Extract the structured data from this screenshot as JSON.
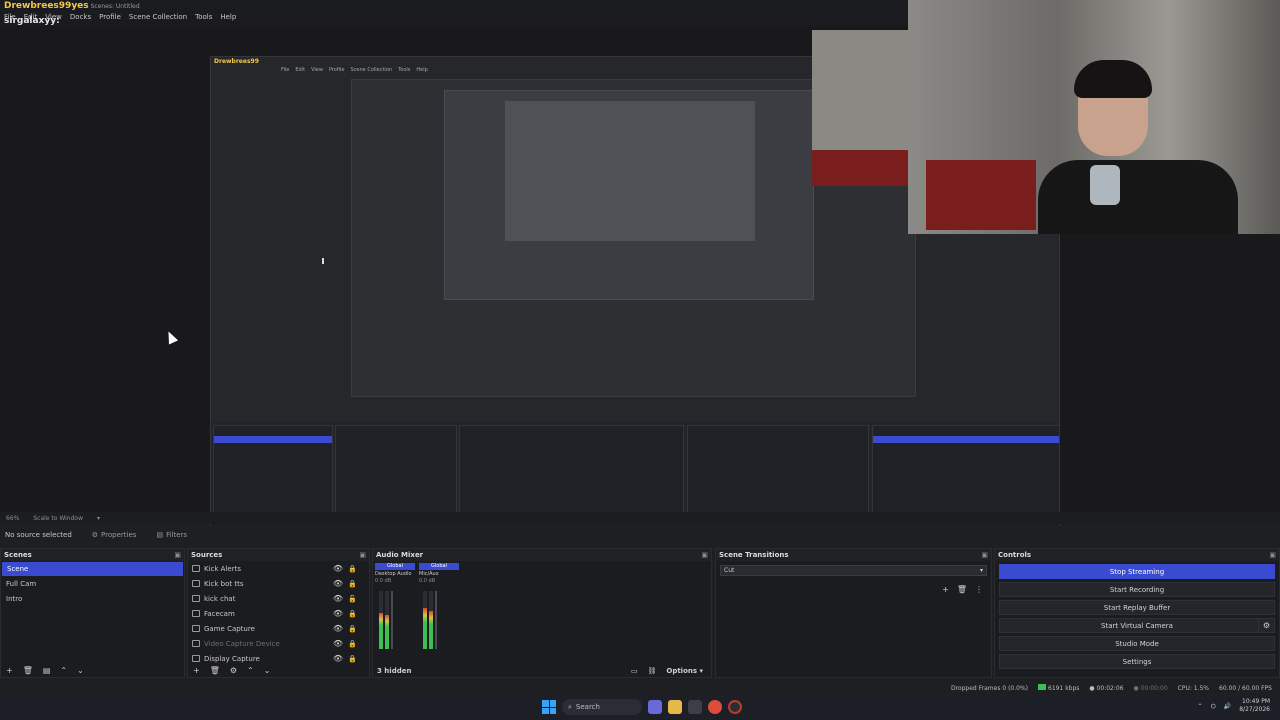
{
  "window": {
    "stream_user": "Drewbrees99",
    "chat_reply": "yes",
    "title": "Scenes: Untitled",
    "menu": [
      "File",
      "Edit",
      "View",
      "Docks",
      "Profile",
      "Scene Collection",
      "Tools",
      "Help"
    ],
    "chat_handle": "sirgalaxyy:"
  },
  "zoom": {
    "level": "66%",
    "mode": "Scale to Window"
  },
  "props_bar": {
    "selection": "No source selected",
    "properties": "Properties",
    "filters": "Filters"
  },
  "scenes": {
    "title": "Scenes",
    "items": [
      {
        "label": "Scene",
        "active": true
      },
      {
        "label": "Full Cam",
        "active": false
      },
      {
        "label": "Intro",
        "active": false
      }
    ]
  },
  "sources": {
    "title": "Sources",
    "items": [
      {
        "label": "Kick Alerts"
      },
      {
        "label": "Kick bot tts"
      },
      {
        "label": "kick chat"
      },
      {
        "label": "Facecam"
      },
      {
        "label": "Game Capture"
      },
      {
        "label": "Video Capture Device",
        "disabled": true
      },
      {
        "label": "Display Capture"
      }
    ]
  },
  "mixer": {
    "title": "Audio Mixer",
    "channels": [
      {
        "scope": "Global",
        "name": "Desktop Audio",
        "db": "0.0 dB",
        "level": 0.62
      },
      {
        "scope": "Global",
        "name": "Mic/Aux",
        "db": "0.0 dB",
        "level": 0.7
      }
    ],
    "hidden": "3 hidden",
    "options": "Options"
  },
  "transitions": {
    "title": "Scene Transitions",
    "selected": "Cut"
  },
  "controls": {
    "title": "Controls",
    "buttons": {
      "stop_streaming": "Stop Streaming",
      "start_recording": "Start Recording",
      "start_replay": "Start Replay Buffer",
      "start_virtual_camera": "Start Virtual Camera",
      "studio_mode": "Studio Mode",
      "settings": "Settings"
    }
  },
  "status": {
    "dropped_frames": "Dropped Frames 0 (0.0%)",
    "bitrate": "6191 kbps",
    "stream_time": "00:02:06",
    "rec_time": "00:00:00",
    "cpu": "CPU: 1.5%",
    "fps": "60.00 / 60.00 FPS"
  },
  "taskbar": {
    "search": "Search",
    "time": "10:49 PM",
    "date": "8/27/2026"
  },
  "colors": {
    "accent": "#3b4bd1",
    "meter_green": "#3dbf52",
    "name_gold": "#f2c94c"
  }
}
